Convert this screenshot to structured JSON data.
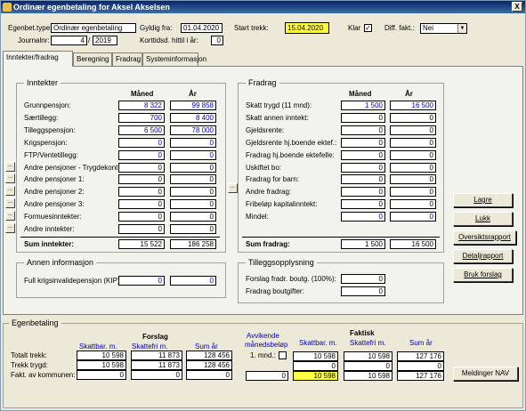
{
  "window": {
    "title": "Ordinær egenbetaling for Aksel Akselsen",
    "close": "X"
  },
  "header": {
    "egenbet_type_label": "Egenbet.type:",
    "egenbet_type_value": "Ordinær egenbetaling",
    "gyldig_fra_label": "Gyldig fra:",
    "gyldig_fra_value": "01.04.2020",
    "start_trekk_label": "Start trekk:",
    "start_trekk_value": "15.04.2020",
    "klar_label": "Klar",
    "klar_checked": "✓",
    "diff_fakt_label": "Diff. fakt.:",
    "diff_fakt_value": "Nei",
    "journalnr_label": "Journalnr:",
    "journalnr_value": "4",
    "journalnr_year": "2019",
    "journalnr_sep": "/",
    "korttidsd_label": "Korttidsd. hittil i år:",
    "korttidsd_value": "0"
  },
  "tabs": [
    "Inntekter/fradrag",
    "Beregning",
    "Fradrag",
    "Systeminformasjon"
  ],
  "inntekter": {
    "title": "Inntekter",
    "col_maned": "Måned",
    "col_ar": "År",
    "rows": [
      {
        "label": "Grunnpensjon:",
        "maned": "8 322",
        "ar": "99 858",
        "blue": true,
        "btn": false
      },
      {
        "label": "Særtillegg:",
        "maned": "700",
        "ar": "8 400",
        "blue": true,
        "btn": false
      },
      {
        "label": "Tilleggspensjon:",
        "maned": "6 500",
        "ar": "78 000",
        "blue": true,
        "btn": false
      },
      {
        "label": "Krigspensjon:",
        "maned": "0",
        "ar": "0",
        "blue": true,
        "btn": false
      },
      {
        "label": "FTP/Ventetillegg:",
        "maned": "0",
        "ar": "0",
        "blue": true,
        "btn": false
      },
      {
        "label": "Andre pensjoner - Trygdekont.:",
        "maned": "0",
        "ar": "0",
        "blue": false,
        "btn": true
      },
      {
        "label": "Andre pensjoner 1:",
        "maned": "0",
        "ar": "0",
        "blue": false,
        "btn": true
      },
      {
        "label": "Andre pensjoner 2:",
        "maned": "0",
        "ar": "0",
        "blue": false,
        "btn": true
      },
      {
        "label": "Andre pensjoner 3:",
        "maned": "0",
        "ar": "0",
        "blue": false,
        "btn": true
      },
      {
        "label": "Formuesinntekter:",
        "maned": "0",
        "ar": "0",
        "blue": false,
        "btn": true
      },
      {
        "label": "Andre inntekter:",
        "maned": "0",
        "ar": "0",
        "blue": false,
        "btn": true
      }
    ],
    "sum_label": "Sum inntekter:",
    "sum_maned": "15 522",
    "sum_ar": "186 258"
  },
  "fradrag": {
    "title": "Fradrag",
    "col_maned": "Måned",
    "col_ar": "År",
    "rows": [
      {
        "label": "Skatt trygd (11 mnd):",
        "maned": "1 500",
        "ar": "16 500",
        "blue": true
      },
      {
        "label": "Skatt annen inntekt:",
        "maned": "0",
        "ar": "0",
        "blue": false
      },
      {
        "label": "Gjeldsrente:",
        "maned": "0",
        "ar": "0",
        "blue": false
      },
      {
        "label": "Gjeldsrente hj.boende ektef.:",
        "maned": "0",
        "ar": "0",
        "blue": false
      },
      {
        "label": "Fradrag hj.boende ektefelle:",
        "maned": "0",
        "ar": "0",
        "blue": false
      },
      {
        "label": "Uskiftet bo:",
        "maned": "0",
        "ar": "0",
        "blue": false
      },
      {
        "label": "Fradrag for barn:",
        "maned": "0",
        "ar": "0",
        "blue": false
      },
      {
        "label": "Andre fradrag:",
        "maned": "0",
        "ar": "0",
        "blue": false
      },
      {
        "label": "Fribeløp kapitalinntekt:",
        "maned": "0",
        "ar": "0",
        "blue": false
      },
      {
        "label": "Mindel:",
        "maned": "0",
        "ar": "0",
        "blue": true
      }
    ],
    "sum_label": "Sum fradrag:",
    "sum_maned": "1 500",
    "sum_ar": "16 500"
  },
  "annen": {
    "title": "Annen informasjon",
    "row_label": "Full krigsinvalidepensjon (KIP):",
    "maned": "0",
    "ar": "0"
  },
  "tillegg": {
    "title": "Tilleggsopplysning",
    "rows": [
      {
        "label": "Forslag fradr. boutg. (100%):",
        "value": "0"
      },
      {
        "label": "Fradrag boutgifter:",
        "value": "0"
      }
    ]
  },
  "buttons": {
    "lagre": "Lagre",
    "lukk": "Lukk",
    "oversikt": "Oversiktsrapport",
    "detalj": "Detaljrapport",
    "bruk": "Bruk forslag",
    "meldinger": "Meldinger NAV"
  },
  "egenbetaling": {
    "title": "Egenbetaling",
    "forslag_title": "Forslag",
    "faktisk_title": "Faktisk",
    "avvikende_label": "Avvikende",
    "manedsbelop_label": "månedsbeløp",
    "col_skattbar": "Skattbar. m.",
    "col_skattefri": "Skattefri m.",
    "col_sum": "Sum år",
    "mnd_label": "1. mnd.:",
    "rows": [
      {
        "label": "Totalt trekk:",
        "f_skattbar": "10 598",
        "f_skattefri": "11 873",
        "f_sum": "128 456",
        "k_skattbar": "10 598",
        "k_skattefri": "10 598",
        "k_sum": "127 176"
      },
      {
        "label": "Trekk trygd:",
        "f_skattbar": "10 598",
        "f_skattefri": "11 873",
        "f_sum": "128 456",
        "k_skattbar": "0",
        "k_skattefri": "0",
        "k_sum": "0"
      },
      {
        "label": "Fakt. av kommunen:",
        "f_skattbar": "0",
        "f_skattefri": "0",
        "f_sum": "0",
        "avvik": "0",
        "k_skattbar": "10 598",
        "k_skattefri": "10 598",
        "k_sum": "127 176"
      }
    ]
  },
  "colors": {
    "highlight": "#ffff40",
    "title_bar": "#0a246a",
    "blue_value": "#0000c0",
    "panel_bg": "#f3f3ee",
    "window_bg": "#ece9d8"
  }
}
